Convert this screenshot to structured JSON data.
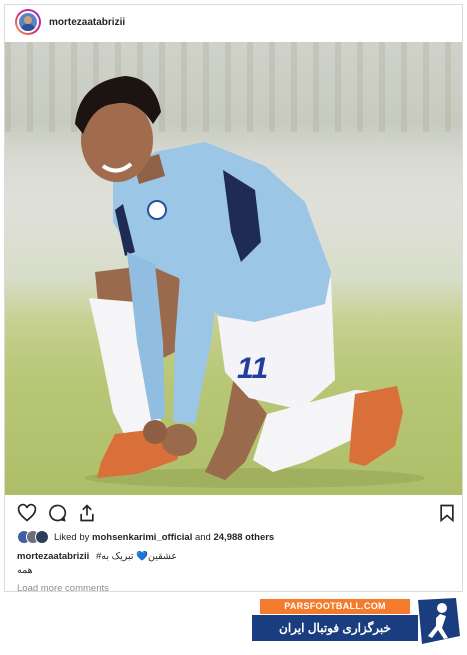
{
  "post": {
    "username": "mortezaatabrizii"
  },
  "icons": {
    "avatar": "profile-avatar",
    "like": "heart-outline-icon",
    "comment": "comment-bubble-icon",
    "share": "share-icon",
    "save": "bookmark-icon"
  },
  "likes": {
    "prefix": "Liked by ",
    "user": "mohsenkarimi_official",
    "middle": " and ",
    "count": "24,988 others"
  },
  "caption": {
    "username": "mortezaatabrizii",
    "text": "عشقین💙 تبریک به#",
    "line2": "همه"
  },
  "comments": {
    "load_more": "Load more comments"
  },
  "watermark": {
    "site": "PARSFOOTBALL.COM",
    "tagline": "خبرگزاری فوتبال ایران"
  },
  "colors": {
    "banner_orange": "#f47a2c",
    "banner_blue": "#1a3d80",
    "jersey": "#9cc6e6"
  }
}
